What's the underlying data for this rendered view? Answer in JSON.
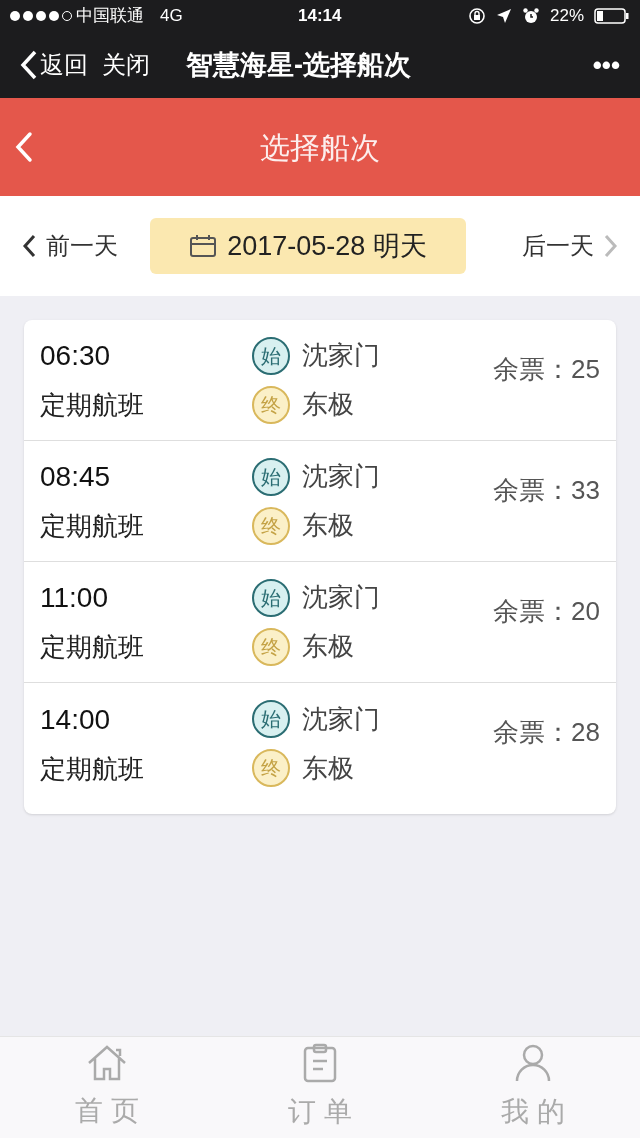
{
  "status_bar": {
    "carrier": "中国联通",
    "network": "4G",
    "time": "14:14",
    "battery": "22%"
  },
  "nav_bar": {
    "back": "返回",
    "close": "关闭",
    "title": "智慧海星-选择船次",
    "more": "•••"
  },
  "header": {
    "title": "选择船次"
  },
  "date_bar": {
    "prev": "前一天",
    "date": "2017-05-28 明天",
    "next": "后一天"
  },
  "trips": [
    {
      "time": "06:30",
      "type": "定期航班",
      "start_badge": "始",
      "start": "沈家门",
      "end_badge": "终",
      "end": "东极",
      "tickets": "余票：25"
    },
    {
      "time": "08:45",
      "type": "定期航班",
      "start_badge": "始",
      "start": "沈家门",
      "end_badge": "终",
      "end": "东极",
      "tickets": "余票：33"
    },
    {
      "time": "11:00",
      "type": "定期航班",
      "start_badge": "始",
      "start": "沈家门",
      "end_badge": "终",
      "end": "东极",
      "tickets": "余票：20"
    },
    {
      "time": "14:00",
      "type": "定期航班",
      "start_badge": "始",
      "start": "沈家门",
      "end_badge": "终",
      "end": "东极",
      "tickets": "余票：28"
    }
  ],
  "tab_bar": [
    {
      "kind": "home",
      "label": "首 页"
    },
    {
      "kind": "orders",
      "label": "订 单"
    },
    {
      "kind": "profile",
      "label": "我 的"
    }
  ]
}
